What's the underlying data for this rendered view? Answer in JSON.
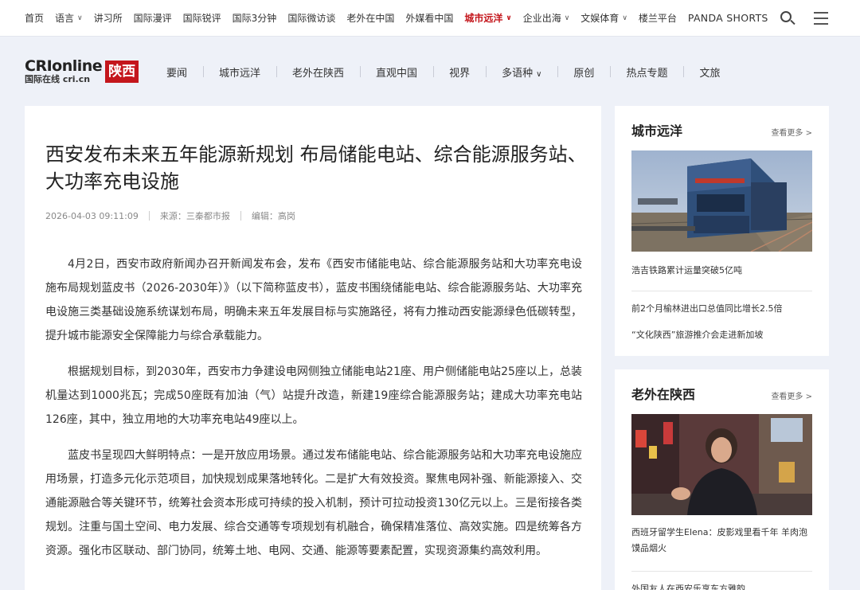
{
  "topnav": {
    "items": [
      {
        "label": "首页"
      },
      {
        "label": "语言",
        "dropdown": true
      },
      {
        "label": "讲习所"
      },
      {
        "label": "国际漫评"
      },
      {
        "label": "国际锐评"
      },
      {
        "label": "国际3分钟"
      },
      {
        "label": "国际微访谈"
      },
      {
        "label": "老外在中国"
      },
      {
        "label": "外媒看中国"
      },
      {
        "label": "城市远洋",
        "dropdown": true,
        "active": true
      },
      {
        "label": "企业出海",
        "dropdown": true
      },
      {
        "label": "文娱体育",
        "dropdown": true
      },
      {
        "label": "楼兰平台"
      },
      {
        "label": "PANDA SHORTS"
      }
    ],
    "icons": [
      "search-icon",
      "menu-icon"
    ]
  },
  "site": {
    "logo_main": "CRIonline",
    "logo_sub": "国际在线 cri.cn",
    "logo_region": "陕西",
    "nav": [
      "要闻",
      "城市远洋",
      "老外在陕西",
      "直观中国",
      "视界",
      "多语种",
      "原创",
      "热点专题",
      "文旅"
    ]
  },
  "article": {
    "title": "西安发布未来五年能源新规划 布局储能电站、综合能源服务站、大功率充电设施",
    "date": "2026-04-03 09:11:09",
    "source": "来源：三秦都市报",
    "editor": "编辑：高岗",
    "paragraphs": [
      "4月2日，西安市政府新闻办召开新闻发布会，发布《西安市储能电站、综合能源服务站和大功率充电设施布局规划蓝皮书（2026-2030年）》（以下简称蓝皮书），蓝皮书围绕储能电站、综合能源服务站、大功率充电设施三类基础设施系统谋划布局，明确未来五年发展目标与实施路径，将有力推动西安能源绿色低碳转型，提升城市能源安全保障能力与综合承载能力。",
      "根据规划目标，到2030年，西安市力争建设电网侧独立储能电站21座、用户侧储能电站25座以上，总装机量达到1000兆瓦；完成50座既有加油（气）站提升改造，新建19座综合能源服务站；建成大功率充电站126座，其中，独立用地的大功率充电站49座以上。",
      "蓝皮书呈现四大鲜明特点：一是开放应用场景。通过发布储能电站、综合能源服务站和大功率充电设施应用场景，打造多元化示范项目，加快规划成果落地转化。二是扩大有效投资。聚焦电网补强、新能源接入、交通能源融合等关键环节，统筹社会资本形成可持续的投入机制，预计可拉动投资130亿元以上。三是衔接各类规划。注重与国土空间、电力发展、综合交通等专项规划有机融合，确保精准落位、高效实施。四是统筹各方资源。强化市区联动、部门协同，统筹土地、电网、交通、能源等要素配置，实现资源集约高效利用。"
    ]
  },
  "sidebar": {
    "card1": {
      "title": "城市远洋",
      "more": "查看更多 >",
      "caption": "浩吉铁路累计运量突破5亿吨",
      "links": [
        "前2个月榆林进出口总值同比增长2.5倍",
        "“文化陕西”旅游推介会走进新加坡"
      ]
    },
    "card2": {
      "title": "老外在陕西",
      "more": "查看更多 >",
      "caption": "西班牙留学生Elena：皮影戏里看千年 羊肉泡馍品烟火",
      "links": [
        "外国友人在西安乐享东方雅韵"
      ]
    }
  },
  "colors": {
    "accent": "#c4161c",
    "background": "#eef1f8"
  }
}
